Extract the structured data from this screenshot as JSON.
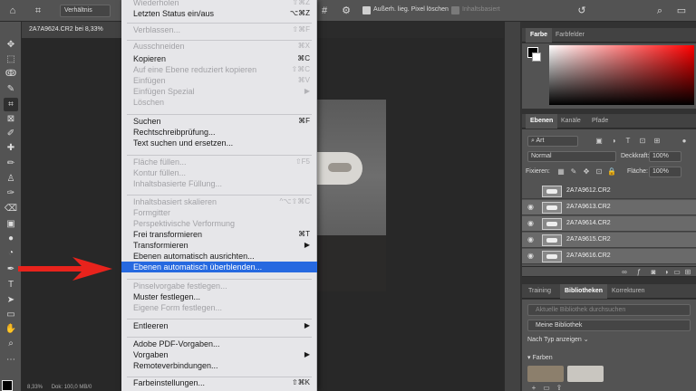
{
  "options_bar": {
    "ratio_select": "Verhältnis",
    "checkbox_label": "Außerh. lieg. Pixel löschen",
    "content_aware": "Inhaltsbasiert"
  },
  "document_tab": {
    "title": "2A7A9624.CR2 bei 8,33%"
  },
  "status_bar": {
    "zoom": "8,33%",
    "info": "Dok: 100,0 MB/0"
  },
  "edit_menu": {
    "items": [
      {
        "label": "Wiederholen",
        "shortcut": "⇧⌘Z",
        "enabled": false
      },
      {
        "label": "Letzten Status ein/aus",
        "shortcut": "⌥⌘Z",
        "enabled": true
      },
      {
        "label": "Verblassen...",
        "shortcut": "⇧⌘F",
        "enabled": false
      },
      {
        "label": "Ausschneiden",
        "shortcut": "⌘X",
        "enabled": false
      },
      {
        "label": "Kopieren",
        "shortcut": "⌘C",
        "enabled": true
      },
      {
        "label": "Auf eine Ebene reduziert kopieren",
        "shortcut": "⇧⌘C",
        "enabled": false
      },
      {
        "label": "Einfügen",
        "shortcut": "⌘V",
        "enabled": false
      },
      {
        "label": "Einfügen Spezial",
        "shortcut": "▶",
        "enabled": false
      },
      {
        "label": "Löschen",
        "shortcut": "",
        "enabled": false
      },
      {
        "label": "Suchen",
        "shortcut": "⌘F",
        "enabled": true
      },
      {
        "label": "Rechtschreibprüfung...",
        "shortcut": "",
        "enabled": true
      },
      {
        "label": "Text suchen und ersetzen...",
        "shortcut": "",
        "enabled": true
      },
      {
        "label": "Fläche füllen...",
        "shortcut": "⇧F5",
        "enabled": false
      },
      {
        "label": "Kontur füllen...",
        "shortcut": "",
        "enabled": false
      },
      {
        "label": "Inhaltsbasierte Füllung...",
        "shortcut": "",
        "enabled": false
      },
      {
        "label": "Inhaltsbasiert skalieren",
        "shortcut": "^⌥⇧⌘C",
        "enabled": false
      },
      {
        "label": "Formgitter",
        "shortcut": "",
        "enabled": false
      },
      {
        "label": "Perspektivische Verformung",
        "shortcut": "",
        "enabled": false
      },
      {
        "label": "Frei transformieren",
        "shortcut": "⌘T",
        "enabled": true
      },
      {
        "label": "Transformieren",
        "shortcut": "▶",
        "enabled": true
      },
      {
        "label": "Ebenen automatisch ausrichten...",
        "shortcut": "",
        "enabled": true
      },
      {
        "label": "Ebenen automatisch überblenden...",
        "shortcut": "",
        "enabled": true,
        "highlighted": true
      },
      {
        "label": "Pinselvorgabe festlegen...",
        "shortcut": "",
        "enabled": false
      },
      {
        "label": "Muster festlegen...",
        "shortcut": "",
        "enabled": true
      },
      {
        "label": "Eigene Form festlegen...",
        "shortcut": "",
        "enabled": false
      },
      {
        "label": "Entleeren",
        "shortcut": "▶",
        "enabled": true
      },
      {
        "label": "Adobe PDF-Vorgaben...",
        "shortcut": "",
        "enabled": true
      },
      {
        "label": "Vorgaben",
        "shortcut": "▶",
        "enabled": true
      },
      {
        "label": "Remoteverbindungen...",
        "shortcut": "",
        "enabled": true
      },
      {
        "label": "Farbeinstellungen...",
        "shortcut": "⇧⌘K",
        "enabled": true
      }
    ]
  },
  "color_panel": {
    "tabs": [
      "Farbe",
      "Farbfelder"
    ],
    "fg_color": "#000000",
    "bg_color": "#ffffff"
  },
  "layers_panel": {
    "tabs": [
      "Ebenen",
      "Kanäle",
      "Pfade"
    ],
    "filter": "Art",
    "blend_mode": "Normal",
    "opacity_label": "Deckkraft:",
    "opacity_value": "100%",
    "lock_label": "Fixieren:",
    "fill_label": "Fläche:",
    "fill_value": "100%",
    "layers": [
      {
        "name": "2A7A9612.CR2",
        "visible": false,
        "selected": false
      },
      {
        "name": "2A7A9613.CR2",
        "visible": true,
        "selected": true
      },
      {
        "name": "2A7A9614.CR2",
        "visible": true,
        "selected": true
      },
      {
        "name": "2A7A9615.CR2",
        "visible": true,
        "selected": true
      },
      {
        "name": "2A7A9616.CR2",
        "visible": true,
        "selected": true
      }
    ]
  },
  "libraries_panel": {
    "tabs": [
      "Training",
      "Bibliotheken",
      "Korrekturen"
    ],
    "search_placeholder": "Aktuelle Bibliothek durchsuchen",
    "library": "Meine Bibliothek",
    "sort": "Nach Typ anzeigen",
    "section": "Farben",
    "swatches": [
      "#8c7f6c",
      "#c9c6c0"
    ]
  }
}
